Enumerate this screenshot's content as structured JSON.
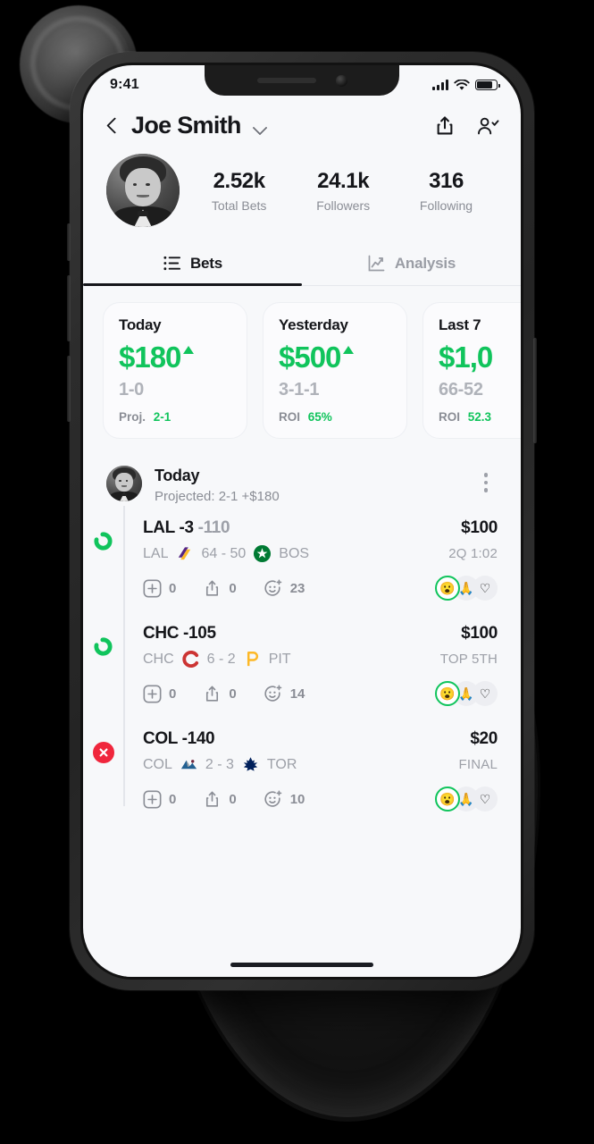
{
  "theme": {
    "green": "#10C45C",
    "red": "#F0263C",
    "ink": "#15161A",
    "muted": "#8A8D95",
    "screen_bg": "#F7F8FA"
  },
  "status_bar": {
    "time": "9:41",
    "signal_icon": "cellular-bars-icon",
    "wifi_icon": "wifi-icon",
    "battery_icon": "battery-icon"
  },
  "nav": {
    "back_icon": "chevron-left-icon",
    "title": "Joe Smith",
    "dropdown_icon": "chevron-down-icon",
    "share_icon": "share-icon",
    "add_friend_icon": "add-user-icon"
  },
  "profile": {
    "avatar_icon": "user-avatar",
    "stats": [
      {
        "value": "2.52k",
        "label": "Total Bets"
      },
      {
        "value": "24.1k",
        "label": "Followers"
      },
      {
        "value": "316",
        "label": "Following"
      }
    ]
  },
  "tabs": [
    {
      "label": "Bets",
      "icon": "list-icon",
      "active": true
    },
    {
      "label": "Analysis",
      "icon": "line-chart-icon",
      "active": false
    }
  ],
  "summary_cards": [
    {
      "title": "Today",
      "amount": "$180",
      "trend": "up",
      "record": "1-0",
      "foot_label": "Proj.",
      "foot_value": "2-1"
    },
    {
      "title": "Yesterday",
      "amount": "$500",
      "trend": "up",
      "record": "3-1-1",
      "foot_label": "ROI",
      "foot_value": "65%"
    },
    {
      "title": "Last 7",
      "amount": "$1,0",
      "trend": "none",
      "record": "66-52",
      "foot_label": "ROI",
      "foot_value": "52.3"
    }
  ],
  "feed": {
    "avatar_icon": "user-avatar",
    "title": "Today",
    "subtitle": "Projected: 2-1 +$180",
    "more_icon": "more-vertical-icon",
    "bets": [
      {
        "status": "pending",
        "status_icon": "progress-ring-icon",
        "pick": "LAL -3",
        "odds": "-110",
        "stake": "$100",
        "away": "LAL",
        "away_logo": "lakers-logo",
        "score": "64 - 50",
        "home": "BOS",
        "home_logo": "celtics-logo",
        "time": "2Q 1:02",
        "actions": [
          {
            "icon": "plus-square-icon",
            "count": "0"
          },
          {
            "icon": "share-icon",
            "count": "0"
          },
          {
            "icon": "add-reaction-icon",
            "count": "23"
          }
        ],
        "reactions": [
          "😮",
          "🙏",
          "♡"
        ]
      },
      {
        "status": "pending",
        "status_icon": "progress-ring-icon",
        "pick": "CHC -105",
        "odds": "",
        "stake": "$100",
        "away": "CHC",
        "away_logo": "cubs-logo",
        "score": "6 - 2",
        "home": "PIT",
        "home_logo": "pirates-logo",
        "time": "TOP 5TH",
        "actions": [
          {
            "icon": "plus-square-icon",
            "count": "0"
          },
          {
            "icon": "share-icon",
            "count": "0"
          },
          {
            "icon": "add-reaction-icon",
            "count": "14"
          }
        ],
        "reactions": [
          "😮",
          "🙏",
          "♡"
        ]
      },
      {
        "status": "lost",
        "status_icon": "x-circle-icon",
        "pick": "COL -140",
        "odds": "",
        "stake": "$20",
        "away": "COL",
        "away_logo": "avalanche-logo",
        "score": "2 - 3",
        "home": "TOR",
        "home_logo": "maple-leafs-logo",
        "time": "FINAL",
        "actions": [
          {
            "icon": "plus-square-icon",
            "count": "0"
          },
          {
            "icon": "share-icon",
            "count": "0"
          },
          {
            "icon": "add-reaction-icon",
            "count": "10"
          }
        ],
        "reactions": [
          "😮",
          "🙏",
          "♡"
        ]
      }
    ]
  }
}
